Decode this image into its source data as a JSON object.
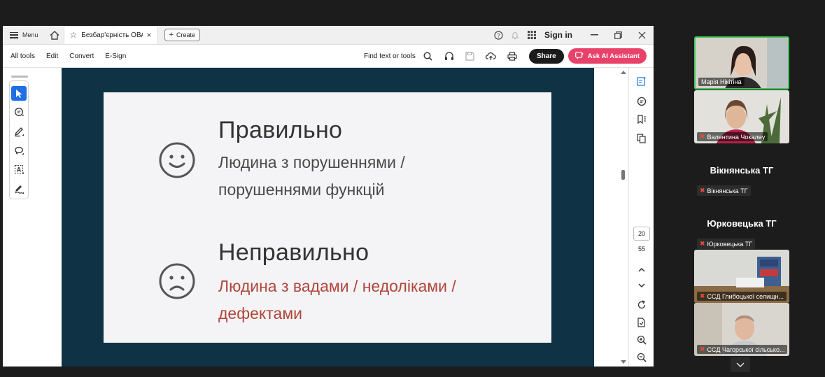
{
  "titlebar": {
    "menu_label": "Menu",
    "tab_label": "Безбар'єрність ОВА",
    "tab_close": "×",
    "create_label": "Create",
    "signin_label": "Sign in"
  },
  "toolbar": {
    "items": [
      "All tools",
      "Edit",
      "Convert",
      "E-Sign"
    ],
    "find_label": "Find text or tools",
    "share_label": "Share",
    "ai_label": "Ask AI Assistant"
  },
  "slide": {
    "correct_heading": "Правильно",
    "correct_line1": "Людина з порушеннями /",
    "correct_line2": "порушеннями функцій",
    "incorrect_heading": "Неправильно",
    "incorrect_line1": "Людина з вадами / недоліками /",
    "incorrect_line2": "дефектами"
  },
  "page_nav": {
    "current": "20",
    "total": "55"
  },
  "participants": {
    "tiles": [
      {
        "name": "Марія Нікітіна"
      },
      {
        "name": "Валентина Чокалеу"
      },
      {
        "name": "ССД Глибоцької селищн..."
      },
      {
        "name": "ССД Чагорської сільсько..."
      }
    ],
    "named": [
      {
        "title": "Вікнянська ТГ",
        "badge": "Вікнянська ТГ"
      },
      {
        "title": "Юрковецька ТГ",
        "badge": "Юрковецька ТГ"
      }
    ]
  },
  "colors": {
    "accent_blue": "#1f6fe5",
    "ai_pink": "#e9426a",
    "slide_bg": "#0f3344",
    "incorrect_red": "#b0463a",
    "speaker_green": "#45c45d"
  }
}
